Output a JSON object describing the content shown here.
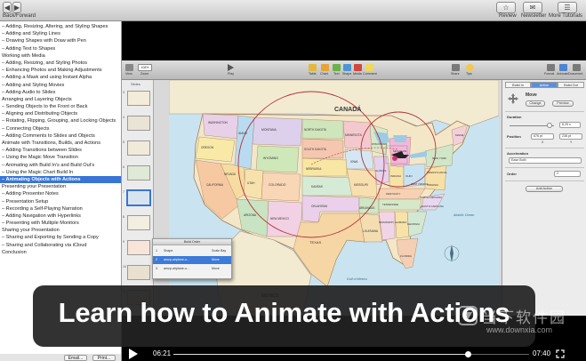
{
  "toolbar": {
    "back_forward_label": "Back/Forward",
    "review_label": "Review",
    "newsletter_label": "Newsletter",
    "more_tutorials_label": "More Tutorials"
  },
  "sidebar": {
    "items": [
      {
        "label": "– Adding, Resizing, Altering, and Styling Shapes",
        "sub": true
      },
      {
        "label": "– Adding and Styling Lines",
        "sub": true
      },
      {
        "label": "– Drawing Shapes with Draw with Pen",
        "sub": true
      },
      {
        "label": "– Adding Text to Shapes",
        "sub": true
      },
      {
        "label": "Working with Media",
        "sub": false
      },
      {
        "label": "– Adding, Resizing, and Styling Photos",
        "sub": true
      },
      {
        "label": "– Enhancing Photos and Making Adjustments",
        "sub": true
      },
      {
        "label": "– Adding a Mask and using Instant Alpha",
        "sub": true
      },
      {
        "label": "– Adding and Styling Movies",
        "sub": true
      },
      {
        "label": "– Adding Audio to Slides",
        "sub": true
      },
      {
        "label": "Arranging and Layering Objects",
        "sub": false
      },
      {
        "label": "– Sending Objects to the Front or Back",
        "sub": true
      },
      {
        "label": "– Aligning and Distributing Objects",
        "sub": true
      },
      {
        "label": "– Rotating, Flipping, Grouping, and Locking Objects",
        "sub": true
      },
      {
        "label": "– Connecting Objects",
        "sub": true
      },
      {
        "label": "– Adding Comments to Slides and Objects",
        "sub": true
      },
      {
        "label": "Animate with Transitions, Builds, and Actions",
        "sub": false
      },
      {
        "label": "– Adding Transitions between Slides",
        "sub": true
      },
      {
        "label": "– Using the Magic Move Transition",
        "sub": true
      },
      {
        "label": "– Animating with Build In's and Build Out's",
        "sub": true
      },
      {
        "label": "– Using the Magic Chart Build In",
        "sub": true
      },
      {
        "label": "– Animating Objects with Actions",
        "sub": true,
        "selected": true
      },
      {
        "label": "Presenting your Presentation",
        "sub": false
      },
      {
        "label": "– Adding Presenter Notes",
        "sub": true
      },
      {
        "label": "– Presentation Setup",
        "sub": true
      },
      {
        "label": "– Recording a Self-Playing Narration",
        "sub": true
      },
      {
        "label": "– Adding Navigation with Hyperlinks",
        "sub": true
      },
      {
        "label": "– Presenting with Multiple Monitors",
        "sub": true
      },
      {
        "label": "Sharing your Presentation",
        "sub": false
      },
      {
        "label": "– Sharing and Exporting by Sending a Copy",
        "sub": true
      },
      {
        "label": "– Sharing and Collaborating via iCloud",
        "sub": true
      },
      {
        "label": "Conclusion",
        "sub": false
      }
    ],
    "footer": {
      "email_label": "Email...",
      "print_label": "Print..."
    }
  },
  "keynote": {
    "toolbar_labels": {
      "view": "View",
      "zoom": "Zoom",
      "zoom_value": "108%",
      "play": "Play",
      "table": "Table",
      "chart": "Chart",
      "text": "Text",
      "shape": "Shape",
      "media": "Media",
      "comment": "Comment",
      "share": "Share",
      "tips": "Tips",
      "format": "Format",
      "animate": "Animate",
      "document": "Document"
    },
    "navigator_title": "Slides",
    "slide_numbers": [
      "3",
      "4",
      "5",
      "6",
      "7",
      "8",
      "9",
      "10",
      "11"
    ],
    "map_labels": {
      "canada": "CANADÁ",
      "mexico": "MEXICO",
      "washington": "WASHINGTON",
      "oregon": "OREGON",
      "california": "CALIFORNIA",
      "nevada": "NEVADA",
      "idaho": "IDAHO",
      "montana": "MONTANA",
      "wyoming": "WYOMING",
      "utah": "UTAH",
      "arizona": "ARIZONA",
      "colorado": "COLORADO",
      "new_mexico": "NEW MEXICO",
      "north_dakota": "NORTH DAKOTA",
      "south_dakota": "SOUTH DAKOTA",
      "nebraska": "NEBRASKA",
      "kansas": "KANSAS",
      "oklahoma": "OKLAHOMA",
      "texas": "TEXAS",
      "minnesota": "MINNESOTA",
      "iowa": "IOWA",
      "missouri": "MISSOURI",
      "arkansas": "ARKANSAS",
      "louisiana": "LOUISIANA",
      "wisconsin": "WISCONSIN",
      "illinois": "ILLINOIS",
      "michigan": "MICHIGAN",
      "indiana": "INDIANA",
      "ohio": "OHIO",
      "kentucky": "KENTUCKY",
      "tennessee": "TENNESSEE",
      "mississippi": "MISSISSIPPI",
      "alabama": "ALABAMA",
      "georgia": "GEORGIA",
      "florida": "FLORIDA",
      "south_carolina": "SOUTH CAROLINA",
      "north_carolina": "NORTH CAROLINA",
      "virginia": "VIRGINIA",
      "west_virginia": "WEST VIRGINIA",
      "pennsylvania": "PENNSYLVANIA",
      "new_york": "NEW YORK",
      "maine": "MAINE",
      "gulf": "Gulf of Mexico",
      "ocean": "Atlantic Ocean"
    },
    "inspector": {
      "tabs": [
        "Build In",
        "Action",
        "Build Out"
      ],
      "effect_name": "Move",
      "change_label": "Change",
      "preview_label": "Preview",
      "duration_label": "Duration",
      "duration_value": "8.25 s",
      "position_label": "Position",
      "position_x": "676 pt",
      "position_y": "238 pt",
      "x_label": "X",
      "y_label": "Y",
      "acceleration_label": "Acceleration",
      "acceleration_value": "Ease Both",
      "order_label": "Order",
      "order_value": "2",
      "add_action_label": "Add Action"
    },
    "build_order": {
      "title": "Build Order",
      "rows": [
        {
          "num": "1",
          "name": "Shape",
          "effect": "Scale Bay",
          "selected": false
        },
        {
          "num": "2",
          "name": "amzp-airplane-o...",
          "effect": "Move",
          "selected": true
        },
        {
          "num": "3",
          "name": "amzp-airplane-o...",
          "effect": "Move",
          "selected": false
        }
      ]
    }
  },
  "caption": "Learn how to Animate with Actions",
  "watermark": {
    "brand": "当下软件园",
    "url": "www.downxia.com"
  },
  "player": {
    "current_time": "06:21",
    "total_time": "07:40",
    "progress": 0.828
  }
}
